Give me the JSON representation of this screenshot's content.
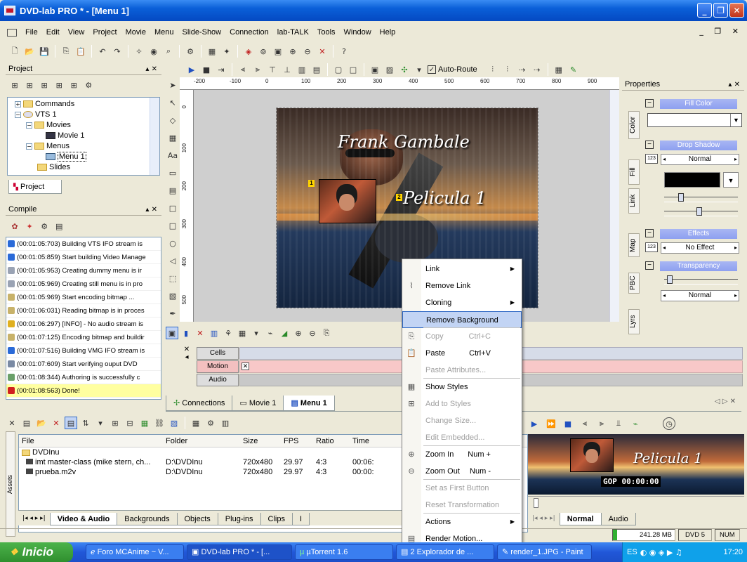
{
  "window": {
    "title": "DVD-lab PRO * - [Menu 1]"
  },
  "menubar": [
    "File",
    "Edit",
    "View",
    "Project",
    "Movie",
    "Menu",
    "Slide-Show",
    "Connection",
    "lab-TALK",
    "Tools",
    "Window",
    "Help"
  ],
  "toolbar2": {
    "auto_route_label": "Auto-Route"
  },
  "project_panel": {
    "title": "Project",
    "tree": [
      {
        "label": "Commands",
        "indent": 0
      },
      {
        "label": "VTS 1",
        "indent": 0
      },
      {
        "label": "Movies",
        "indent": 1
      },
      {
        "label": "Movie 1",
        "indent": 2
      },
      {
        "label": "Menus",
        "indent": 1
      },
      {
        "label": "Menu 1",
        "indent": 2
      },
      {
        "label": "Slides",
        "indent": 1
      }
    ],
    "tab": "Project"
  },
  "compile_panel": {
    "title": "Compile",
    "log": [
      "(00:01:05:703) Building VTS IFO stream is",
      "(00:01:05:859) Start building Video Manage",
      "(00:01:05:953) Creating dummy menu is ir",
      "(00:01:05:969) Creating still menu is in pro",
      "(00:01:05:969) Start encoding bitmap ...",
      "(00:01:06:031) Reading bitmap is in proces",
      "(00:01:06:297) [INFO] - No audio stream is",
      "(00:01:07:125) Encoding bitmap and buildir",
      "(00:01:07:516) Building VMG IFO stream is",
      "(00:01:07:609) Start verifying ouput DVD",
      "(00:01:08:344) Authoring is successfully c",
      "(00:01:08:563) Done!"
    ],
    "log_colors": [
      "#2a6ad8",
      "#2a6ad8",
      "#9aa3b4",
      "#9aa3b4",
      "#c8b26a",
      "#c8b26a",
      "#e0b020",
      "#c8b26a",
      "#2a6ad8",
      "#7a8aa4",
      "#6aa06a",
      "#d02020"
    ]
  },
  "ruler": {
    "ticks": [
      "-200",
      "-100",
      "0",
      "100",
      "200",
      "300",
      "400",
      "500",
      "600",
      "700",
      "800",
      "900"
    ],
    "vticks": [
      "0",
      "100",
      "200",
      "300",
      "400",
      "500"
    ]
  },
  "menu_canvas": {
    "title_text": "Frank Gambale",
    "subtitle_text": "Pelicula 1",
    "button1_num": "1",
    "button2_num": "2"
  },
  "timeline": {
    "tracks": [
      "Cells",
      "Motion",
      "Audio"
    ]
  },
  "editor_tabs": [
    "Connections",
    "Movie 1",
    "Menu 1"
  ],
  "context_menu": {
    "items": [
      {
        "label": "Link",
        "shortcut": "",
        "submenu": true,
        "disabled": false,
        "icon": ""
      },
      {
        "label": "Remove Link",
        "shortcut": "",
        "submenu": false,
        "disabled": false,
        "icon": "unlink-icon"
      },
      {
        "label": "Cloning",
        "shortcut": "",
        "submenu": true,
        "disabled": false,
        "icon": ""
      },
      {
        "label": "Remove Background",
        "shortcut": "",
        "submenu": false,
        "disabled": false,
        "icon": "",
        "highlight": true
      },
      {
        "label": "Copy",
        "shortcut": "Ctrl+C",
        "submenu": false,
        "disabled": true,
        "icon": "copy-icon"
      },
      {
        "label": "Paste",
        "shortcut": "Ctrl+V",
        "submenu": false,
        "disabled": false,
        "icon": "paste-icon"
      },
      {
        "label": "Paste Attributes...",
        "shortcut": "",
        "submenu": false,
        "disabled": true,
        "icon": ""
      },
      {
        "label": "Show Styles",
        "shortcut": "",
        "submenu": false,
        "disabled": false,
        "icon": "styles-icon"
      },
      {
        "label": "Add to Styles",
        "shortcut": "",
        "submenu": false,
        "disabled": true,
        "icon": "add-style-icon"
      },
      {
        "label": "Change Size...",
        "shortcut": "",
        "submenu": false,
        "disabled": true,
        "icon": ""
      },
      {
        "label": "Edit Embedded...",
        "shortcut": "",
        "submenu": false,
        "disabled": true,
        "icon": ""
      },
      {
        "label": "Zoom In",
        "shortcut": "Num +",
        "submenu": false,
        "disabled": false,
        "icon": "zoom-in-icon"
      },
      {
        "label": "Zoom Out",
        "shortcut": "Num -",
        "submenu": false,
        "disabled": false,
        "icon": "zoom-out-icon"
      },
      {
        "label": "Set as First Button",
        "shortcut": "",
        "submenu": false,
        "disabled": true,
        "icon": ""
      },
      {
        "label": "Reset Transformation",
        "shortcut": "",
        "submenu": false,
        "disabled": true,
        "icon": ""
      },
      {
        "label": "Actions",
        "shortcut": "",
        "submenu": true,
        "disabled": false,
        "icon": ""
      },
      {
        "label": "Render Motion...",
        "shortcut": "",
        "submenu": false,
        "disabled": false,
        "icon": "render-icon"
      }
    ]
  },
  "properties": {
    "title": "Properties",
    "vtabs": [
      "Color",
      "Fill",
      "Link",
      "Map",
      "PBC",
      "Lyrs"
    ],
    "fill_color": "Fill Color",
    "drop_shadow": "Drop Shadow",
    "drop_shadow_mode": "Normal",
    "effects": "Effects",
    "effect_value": "No Effect",
    "transparency": "Transparency",
    "transparency_mode": "Normal",
    "num_123": "123"
  },
  "assets": {
    "side_label": "Assets",
    "columns": [
      "File",
      "Folder",
      "Size",
      "FPS",
      "Ratio",
      "Time"
    ],
    "rows": [
      {
        "file": "DVDInu",
        "folder": "",
        "size": "",
        "fps": "",
        "ratio": "",
        "time": ""
      },
      {
        "file": "imt master-class (mike stern, ch...",
        "folder": "D:\\DVDInu",
        "size": "720x480",
        "fps": "29.97",
        "ratio": "4:3",
        "time": "00:06:"
      },
      {
        "file": "prueba.m2v",
        "folder": "D:\\DVDInu",
        "size": "720x480",
        "fps": "29.97",
        "ratio": "4:3",
        "time": "00:00:"
      }
    ],
    "tabs": [
      "Video & Audio",
      "Backgrounds",
      "Objects",
      "Plug-ins",
      "Clips",
      "I"
    ]
  },
  "preview": {
    "title_text": "Pelicula 1",
    "gop": "GOP 00:00:00",
    "tabs": [
      "Normal",
      "Audio"
    ]
  },
  "statusbar": {
    "size": "241.28 MB",
    "dvd": "DVD 5",
    "num": "NUM"
  },
  "taskbar": {
    "start": "Inicio",
    "tasks": [
      "Foro MCAnime ~ V...",
      "DVD-lab PRO * - [...",
      "µTorrent 1.6",
      "2 Explorador de ...",
      "render_1.JPG - Paint"
    ],
    "lang": "ES",
    "clock": "17:20"
  }
}
